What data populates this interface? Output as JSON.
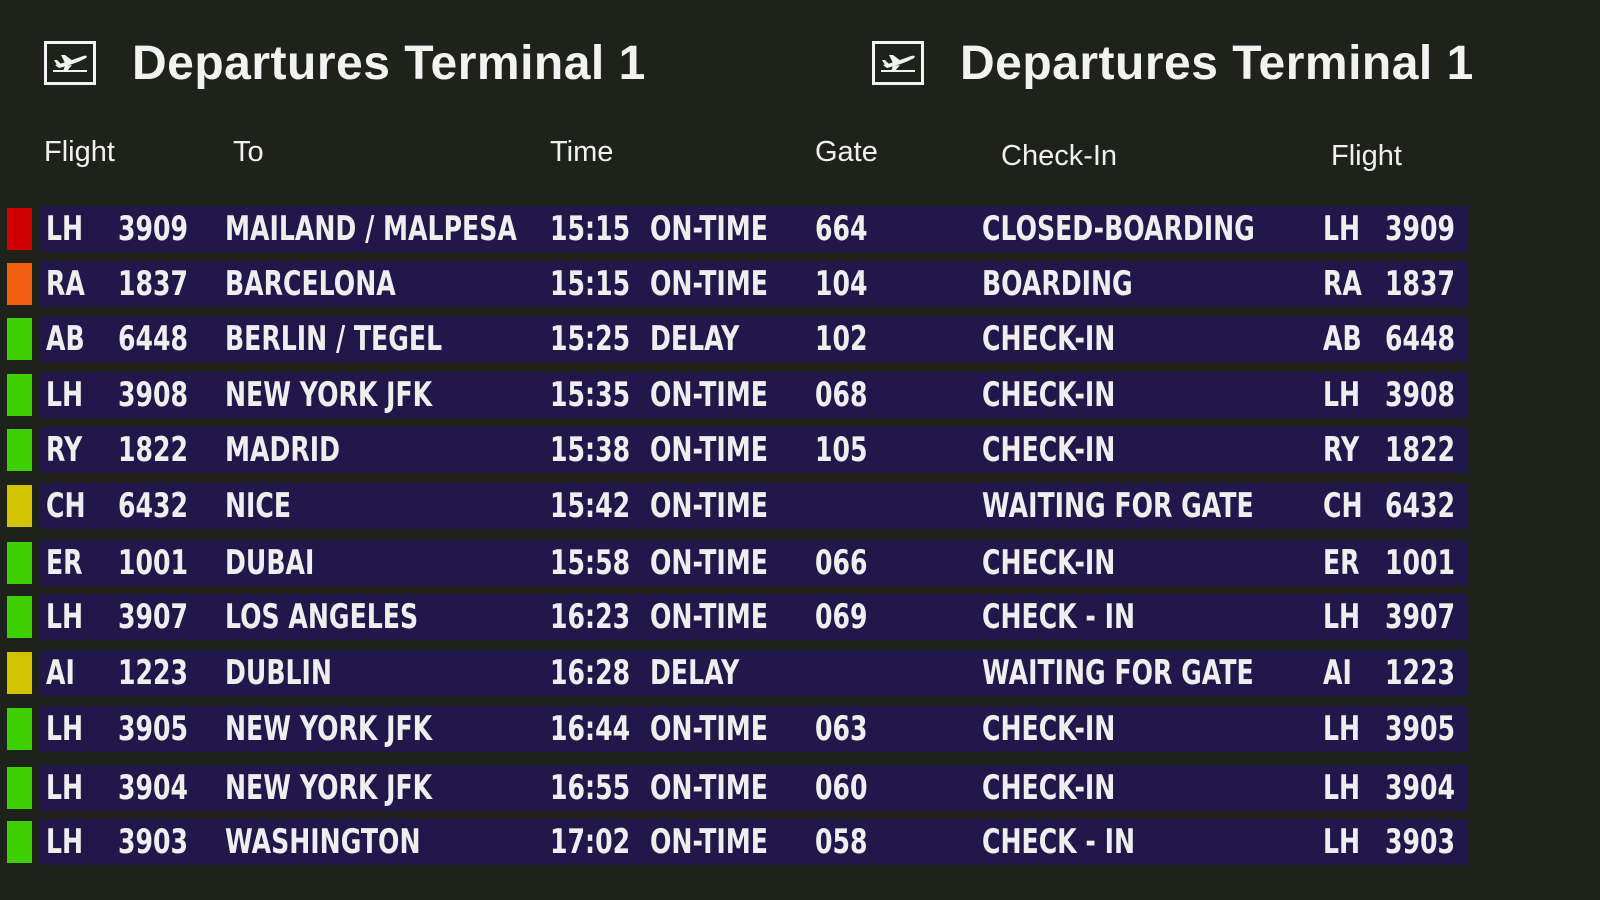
{
  "headers": [
    {
      "title": "Departures Terminal 1",
      "icon": "airplane-departure-icon"
    },
    {
      "title": "Departures Terminal 1",
      "icon": "airplane-departure-icon"
    }
  ],
  "columns": {
    "flight": "Flight",
    "to": "To",
    "time": "Time",
    "gate": "Gate",
    "checkin": "Check-In",
    "flight2": "Flight"
  },
  "status_colors": {
    "red": "#d00000",
    "orange": "#f06010",
    "green": "#3ecf00",
    "yellow": "#d2c300"
  },
  "flights": [
    {
      "status_color": "red",
      "airline": "LH",
      "number": "3909",
      "destination": "MAILAND / MALPESA",
      "time": "15:15",
      "remark": "ON-TIME",
      "gate": "664",
      "checkin": "CLOSED-BOARDING",
      "airline2": "LH",
      "number2": "3909"
    },
    {
      "status_color": "orange",
      "airline": "RA",
      "number": "1837",
      "destination": "BARCELONA",
      "time": "15:15",
      "remark": "ON-TIME",
      "gate": "104",
      "checkin": "BOARDING",
      "airline2": "RA",
      "number2": "1837"
    },
    {
      "status_color": "green",
      "airline": "AB",
      "number": "6448",
      "destination": "BERLIN / TEGEL",
      "time": "15:25",
      "remark": "DELAY",
      "gate": "102",
      "checkin": "CHECK-IN",
      "airline2": "AB",
      "number2": "6448"
    },
    {
      "status_color": "green",
      "airline": "LH",
      "number": "3908",
      "destination": "NEW YORK JFK",
      "time": "15:35",
      "remark": "ON-TIME",
      "gate": "068",
      "checkin": "CHECK-IN",
      "airline2": "LH",
      "number2": "3908"
    },
    {
      "status_color": "green",
      "airline": "RY",
      "number": "1822",
      "destination": "MADRID",
      "time": "15:38",
      "remark": "ON-TIME",
      "gate": "105",
      "checkin": "CHECK-IN",
      "airline2": "RY",
      "number2": "1822"
    },
    {
      "status_color": "yellow",
      "airline": "CH",
      "number": "6432",
      "destination": "NICE",
      "time": "15:42",
      "remark": "ON-TIME",
      "gate": "",
      "checkin": "WAITING FOR GATE",
      "airline2": "CH",
      "number2": "6432"
    },
    {
      "status_color": "green",
      "airline": "ER",
      "number": "1001",
      "destination": "DUBAI",
      "time": "15:58",
      "remark": "ON-TIME",
      "gate": "066",
      "checkin": "CHECK-IN",
      "airline2": "ER",
      "number2": "1001"
    },
    {
      "status_color": "green",
      "airline": "LH",
      "number": "3907",
      "destination": "LOS ANGELES",
      "time": "16:23",
      "remark": "ON-TIME",
      "gate": "069",
      "checkin": "CHECK - IN",
      "airline2": "LH",
      "number2": "3907"
    },
    {
      "status_color": "yellow",
      "airline": "AI",
      "number": "1223",
      "destination": "DUBLIN",
      "time": "16:28",
      "remark": "DELAY",
      "gate": "",
      "checkin": "WAITING FOR GATE",
      "airline2": "AI",
      "number2": "1223"
    },
    {
      "status_color": "green",
      "airline": "LH",
      "number": "3905",
      "destination": "NEW YORK JFK",
      "time": "16:44",
      "remark": "ON-TIME",
      "gate": "063",
      "checkin": "CHECK-IN",
      "airline2": "LH",
      "number2": "3905"
    },
    {
      "status_color": "green",
      "airline": "LH",
      "number": "3904",
      "destination": "NEW YORK JFK",
      "time": "16:55",
      "remark": "ON-TIME",
      "gate": "060",
      "checkin": "CHECK-IN",
      "airline2": "LH",
      "number2": "3904"
    },
    {
      "status_color": "green",
      "airline": "LH",
      "number": "3903",
      "destination": "WASHINGTON",
      "time": "17:02",
      "remark": "ON-TIME",
      "gate": "058",
      "checkin": "CHECK - IN",
      "airline2": "LH",
      "number2": "3903"
    }
  ]
}
